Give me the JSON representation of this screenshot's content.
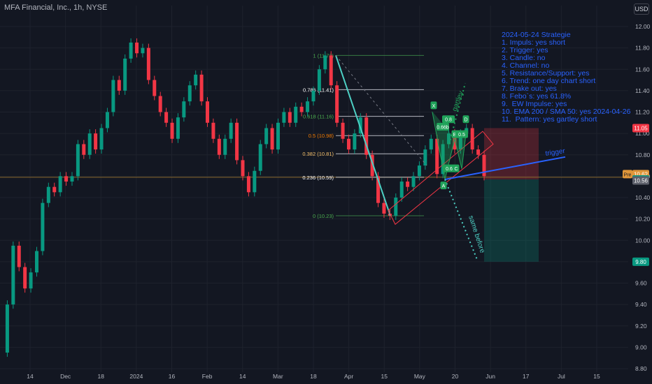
{
  "header": {
    "title": "MFA Financial, Inc., 1h, NYSE",
    "currency": "USD"
  },
  "strategy_note": [
    "2024-05-24 Strategie",
    "1. Impuls: yes short",
    "2. Trigger: yes",
    "3. Candle: no",
    "4. Channel: no",
    "5. Resistance/Support: yes",
    "6. Trend: one day chart short",
    "7. Brake out: yes",
    "8. Febo`s: yes 61.8%",
    "9.  EW Impulse: yes",
    "10. EMA 200 / SMA 50: yes 2024-04-26",
    "11.  Pattern: yes gartley short"
  ],
  "chart_data": {
    "type": "line",
    "title": "MFA Financial, Inc., 1h, NYSE",
    "yunit": "USD",
    "ylim": [
      8.8,
      12.0
    ],
    "y_ticks": [
      "12.00",
      "11.80",
      "11.60",
      "11.40",
      "11.20",
      "11.00",
      "10.80",
      "10.60",
      "10.40",
      "10.20",
      "10.00",
      "9.80",
      "9.60",
      "9.40",
      "9.20",
      "9.00",
      "8.80"
    ],
    "x_ticks": [
      "14",
      "Dec",
      "18",
      "2024",
      "16",
      "Feb",
      "14",
      "Mar",
      "18",
      "Apr",
      "15",
      "May",
      "20",
      "Jun",
      "17",
      "Jul",
      "15"
    ],
    "series": [
      {
        "values": [
          8.95,
          9.4,
          9.95,
          9.75,
          9.55,
          9.7,
          9.9,
          10.35,
          10.5,
          10.45,
          10.6,
          10.55,
          10.6,
          10.9,
          10.8,
          11.0,
          10.85,
          11.05,
          11.2,
          11.5,
          11.4,
          11.7,
          11.85,
          11.75,
          11.8,
          11.5,
          11.35,
          11.2,
          11.1,
          10.95,
          11.15,
          11.3,
          11.45,
          11.55,
          11.3,
          11.1,
          10.95,
          10.8,
          10.95,
          11.1,
          10.75,
          10.6,
          10.45,
          10.65,
          10.9,
          11.05,
          10.85,
          11.1,
          11.2,
          11.1,
          11.25,
          11.2,
          11.3,
          11.4,
          11.6,
          11.73,
          11.45,
          11.1,
          10.95,
          10.85,
          11.0,
          11.15,
          10.8,
          10.6,
          10.35,
          10.25,
          10.23,
          10.4,
          10.55,
          10.5,
          10.6,
          10.7,
          10.85,
          10.95,
          10.62,
          10.9,
          11.0,
          10.85,
          11.0,
          11.05,
          10.85,
          10.8,
          10.6
        ]
      }
    ],
    "fib_levels": [
      {
        "label": "1 (11.73)",
        "value": 11.73
      },
      {
        "label": "0.786 (11.41)",
        "value": 11.41
      },
      {
        "label": "0.618 (11.16)",
        "value": 11.16
      },
      {
        "label": "0.5 (10.98)",
        "value": 10.98
      },
      {
        "label": "0.382 (10.81)",
        "value": 10.81
      },
      {
        "label": "0.236 (10.59)",
        "value": 10.59
      },
      {
        "label": "0 (10.23)",
        "value": 10.23
      }
    ],
    "pattern_labels": [
      "X",
      "0.66b",
      "0.8",
      "D",
      "B",
      "0.5",
      "0.6",
      "C",
      "A"
    ],
    "annotations": [
      "gartley",
      "trigger",
      "same before"
    ],
    "price_tags": [
      {
        "label": "11.05",
        "color": "#f23645"
      },
      {
        "label": "Pre",
        "color": "#e0963a"
      },
      {
        "label": "10.62",
        "color": "#e0963a"
      },
      {
        "label": "10.57",
        "color": "#089981"
      },
      {
        "label": "10.56",
        "color": "#5d606b"
      },
      {
        "label": "9.80",
        "color": "#089981"
      }
    ],
    "colors": {
      "background": "#131722",
      "up": "#089981",
      "down": "#f23645",
      "annotation": "#2962ff",
      "impulse": "#4dd0c4",
      "pattern": "#20a35a"
    }
  }
}
